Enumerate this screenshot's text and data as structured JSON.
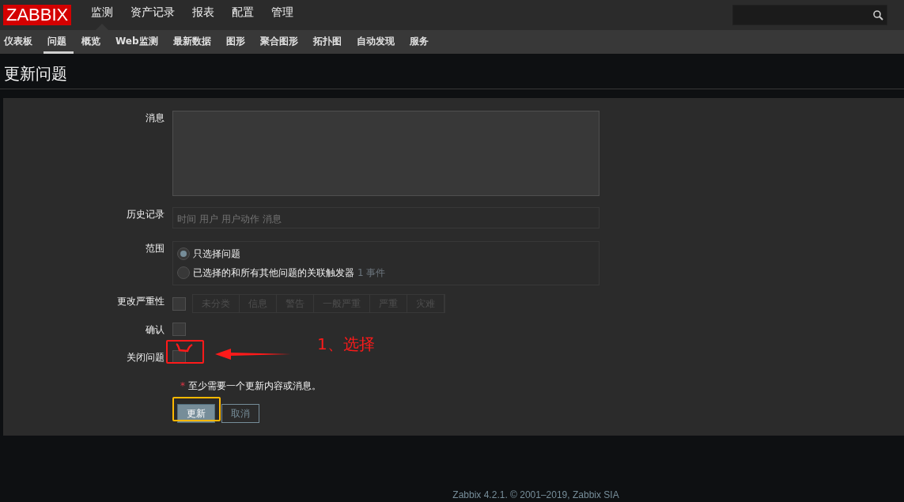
{
  "logo": "ZABBIX",
  "main_menu": [
    {
      "label": "监测",
      "selected": true
    },
    {
      "label": "资产记录",
      "selected": false
    },
    {
      "label": "报表",
      "selected": false
    },
    {
      "label": "配置",
      "selected": false
    },
    {
      "label": "管理",
      "selected": false
    }
  ],
  "sub_menu": [
    {
      "label": "仪表板",
      "selected": false
    },
    {
      "label": "问题",
      "selected": true
    },
    {
      "label": "概览",
      "selected": false
    },
    {
      "label": "Web监测",
      "selected": false
    },
    {
      "label": "最新数据",
      "selected": false
    },
    {
      "label": "图形",
      "selected": false
    },
    {
      "label": "聚合图形",
      "selected": false
    },
    {
      "label": "拓扑图",
      "selected": false
    },
    {
      "label": "自动发现",
      "selected": false
    },
    {
      "label": "服务",
      "selected": false
    }
  ],
  "page_title": "更新问题",
  "form": {
    "message_label": "消息",
    "history_label": "历史记录",
    "history_columns": [
      "时间",
      "用户",
      "用户动作",
      "消息"
    ],
    "scope_label": "范围",
    "scope_options": [
      {
        "label": "只选择问题",
        "selected": true
      },
      {
        "label": "已选择的和所有其他问题的关联触发器",
        "note": "1 事件",
        "selected": false
      }
    ],
    "severity_label": "更改严重性",
    "severity_checked": false,
    "severities": [
      "未分类",
      "信息",
      "警告",
      "一般严重",
      "严重",
      "灾难"
    ],
    "acknowledge_label": "确认",
    "acknowledge_checked": false,
    "close_label": "关闭问题",
    "close_checked": false,
    "required_mark": "*",
    "required_note": "至少需要一个更新内容或消息。",
    "buttons": [
      {
        "label": "更新",
        "kind": "primary"
      },
      {
        "label": "取消",
        "kind": "secondary"
      }
    ]
  },
  "annotation": {
    "text": "1、选择"
  },
  "footer": "Zabbix 4.2.1. © 2001–2019, Zabbix SIA"
}
